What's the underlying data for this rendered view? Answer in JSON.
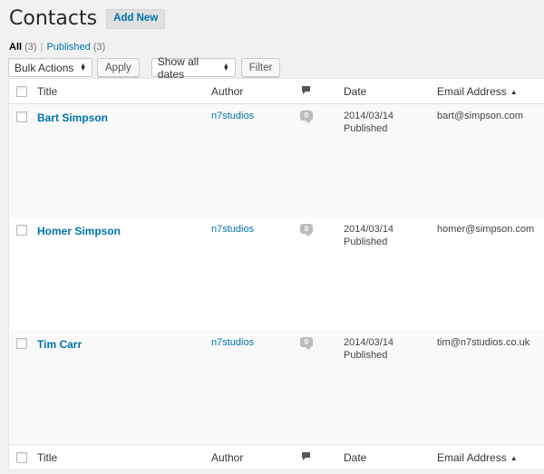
{
  "header": {
    "title": "Contacts",
    "add_new_label": "Add New"
  },
  "filters": {
    "all_label": "All",
    "all_count": "(3)",
    "separator": "|",
    "published_label": "Published",
    "published_count": "(3)"
  },
  "toolbar": {
    "bulk_actions": "Bulk Actions",
    "apply_label": "Apply",
    "dates": "Show all dates",
    "filter_label": "Filter"
  },
  "columns": {
    "title": "Title",
    "author": "Author",
    "comments_icon": "comment-icon",
    "date": "Date",
    "email": "Email Address",
    "email_sort": "▲"
  },
  "rows": [
    {
      "title": "Bart Simpson",
      "author": "n7studios",
      "comments": "0",
      "date": "2014/03/14",
      "status": "Published",
      "email": "bart@simpson.com"
    },
    {
      "title": "Homer Simpson",
      "author": "n7studios",
      "comments": "0",
      "date": "2014/03/14",
      "status": "Published",
      "email": "homer@simpson.com"
    },
    {
      "title": "Tim Carr",
      "author": "n7studios",
      "comments": "0",
      "date": "2014/03/14",
      "status": "Published",
      "email": "tim@n7studios.co.uk"
    }
  ],
  "colors": {
    "link": "#0073aa",
    "background": "#f1f1f1",
    "row_alt": "#f9f9f9"
  }
}
